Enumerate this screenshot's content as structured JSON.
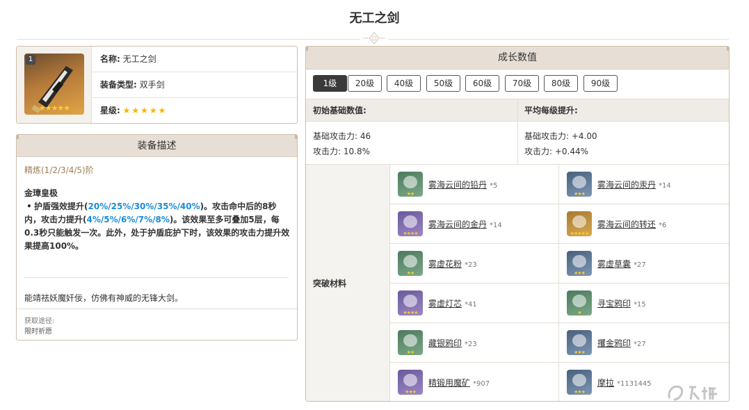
{
  "page": {
    "title": "无工之剑"
  },
  "weapon": {
    "level_badge": "1",
    "icon_stars": "★★★★★",
    "rows": [
      {
        "key": "名称:",
        "value": "无工之剑"
      },
      {
        "key": "装备类型:",
        "value": "双手剑"
      },
      {
        "key": "星级:",
        "value": "★★★★★"
      }
    ],
    "star_count": 5
  },
  "description": {
    "header": "装备描述",
    "refine": "精炼(1/2/3/4/5)阶",
    "effect_name": "金璋皇极",
    "effect_parts": {
      "p1": "护盾强效提升(",
      "h1": "20%/25%/30%/35%/40%",
      "p2": ")。攻击命中后的8秒内，攻击力提升(",
      "h2": "4%/5%/6%/7%/8%",
      "p3": ")。该效果至多可叠加5层，每0.3秒只能触发一次。此外，处于护盾庇护下时，该效果的攻击力提升效果提高100%。"
    },
    "flavor": "能靖祛妖魔奸佞，仿佛有神威的无锋大剑。",
    "source_label": "获取途径:",
    "source_value": "限时祈愿"
  },
  "growth": {
    "header": "成长数值",
    "levels": [
      "1级",
      "20级",
      "40级",
      "50级",
      "60级",
      "70级",
      "80级",
      "90级"
    ],
    "active_level": "1级",
    "base_header": "初始基础数值:",
    "per_level_header": "平均每级提升:",
    "base_stats": [
      "基础攻击力: 46",
      "攻击力: 10.8%"
    ],
    "per_level_stats": [
      "基础攻击力: +4.00",
      "攻击力: +0.44%"
    ],
    "materials_label": "突破材料",
    "materials": [
      {
        "name": "雾海云间的铅丹",
        "count": "*5",
        "icon": "lead-elixir-icon",
        "color": "green",
        "rarity": "★★"
      },
      {
        "name": "雾海云间的汞丹",
        "count": "*14",
        "icon": "mercury-elixir-icon",
        "color": "blue",
        "rarity": "★★★"
      },
      {
        "name": "雾海云间的金丹",
        "count": "*14",
        "icon": "golden-elixir-icon",
        "color": "purple",
        "rarity": "★★★★"
      },
      {
        "name": "雾海云间的转还",
        "count": "*6",
        "icon": "transmutation-icon",
        "color": "gold",
        "rarity": "★★★★★"
      },
      {
        "name": "雾虚花粉",
        "count": "*23",
        "icon": "mist-pollen-icon",
        "color": "green",
        "rarity": "★★"
      },
      {
        "name": "雾虚草囊",
        "count": "*27",
        "icon": "mist-grass-pouch-icon",
        "color": "blue",
        "rarity": "★★★"
      },
      {
        "name": "雾虚灯芯",
        "count": "*41",
        "icon": "mist-lamp-wick-icon",
        "color": "purple",
        "rarity": "★★★★"
      },
      {
        "name": "寻宝鸦印",
        "count": "*15",
        "icon": "treasure-hoarder-insignia-icon",
        "color": "green",
        "rarity": "★"
      },
      {
        "name": "藏银鸦印",
        "count": "*23",
        "icon": "silver-raven-insignia-icon",
        "color": "green",
        "rarity": "★★"
      },
      {
        "name": "攫金鸦印",
        "count": "*27",
        "icon": "golden-raven-insignia-icon",
        "color": "blue",
        "rarity": "★★★"
      },
      {
        "name": "精锻用魔矿",
        "count": "*907",
        "icon": "mystic-enhancement-ore-icon",
        "color": "purple",
        "rarity": "★★★"
      },
      {
        "name": "摩拉",
        "count": "*1131445",
        "icon": "mora-coin-icon",
        "color": "blue",
        "rarity": "★★★"
      }
    ]
  },
  "colors": {
    "accent_blue": "#1a8cd8",
    "header_bg": "#e7dfd6",
    "border": "#cdbdab",
    "refine_text": "#a07c52"
  }
}
